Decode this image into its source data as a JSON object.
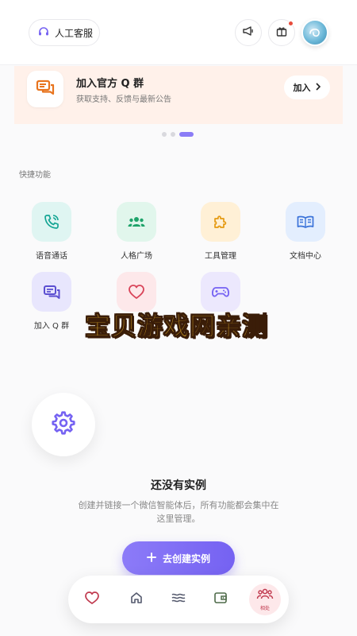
{
  "header": {
    "customer_service_label": "人工客服",
    "avatar_alt": "avatar"
  },
  "banner": {
    "title": "加入官方 Q 群",
    "subtitle": "获取支持、反馈与最新公告",
    "join_label": "加入"
  },
  "carousel": {
    "count": 3,
    "active_index": 2
  },
  "quick": {
    "title": "快捷功能",
    "items": [
      {
        "label": "语音通话",
        "icon": "phone-icon",
        "bg": "#dff5f2",
        "color": "#14a594"
      },
      {
        "label": "人格广场",
        "icon": "people-icon",
        "bg": "#e1f6ec",
        "color": "#1ea36a"
      },
      {
        "label": "工具管理",
        "icon": "puzzle-icon",
        "bg": "#fff0d6",
        "color": "#e59a12"
      },
      {
        "label": "文档中心",
        "icon": "book-icon",
        "bg": "#e3eefe",
        "color": "#3a73d9"
      },
      {
        "label": "加入 Q 群",
        "icon": "chat-icon",
        "bg": "#e8e6fd",
        "color": "#5b4fd1"
      },
      {
        "label": "",
        "icon": "heart-icon",
        "bg": "#fde8ea",
        "color": "#d9455a"
      },
      {
        "label": "",
        "icon": "gamepad-icon",
        "bg": "#ece8fd",
        "color": "#7562f2"
      }
    ]
  },
  "watermark": "宝贝游戏网亲测",
  "empty": {
    "title": "还没有实例",
    "desc_line1": "创建并链接一个微信智能体后，所有功能都会集中在",
    "desc_line2": "这里管理。",
    "create_label": "去创建实例"
  },
  "nav": {
    "items": [
      "heart-icon",
      "home-icon",
      "waves-icon",
      "wallet-icon",
      "group-icon"
    ],
    "active_label": "相处"
  },
  "colors": {
    "accent": "#7562f2",
    "banner_bg": "#fff1ea",
    "banner_icon": "#e8741e"
  }
}
